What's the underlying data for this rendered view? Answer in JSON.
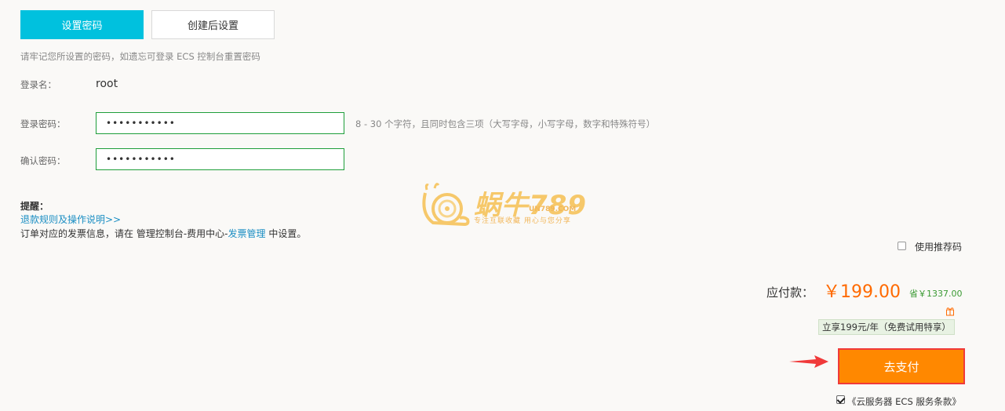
{
  "tabs": {
    "set_password": "设置密码",
    "after_create": "创建后设置"
  },
  "hint_top": "请牢记您所设置的密码，如遗忘可登录 ECS 控制台重置密码",
  "login_name": {
    "label": "登录名：",
    "value": "root"
  },
  "login_password": {
    "label": "登录密码：",
    "value": "•••••••••••",
    "hint": "8 - 30 个字符，且同时包含三项（大写字母，小写字母，数字和特殊符号）"
  },
  "confirm_password": {
    "label": "确认密码：",
    "value": "•••••••••••"
  },
  "reminder": {
    "title": "提醒：",
    "refund_link": "退款规则及操作说明>>",
    "invoice_prefix": "订单对应的发票信息，请在 管理控制台-费用中心-",
    "invoice_link": "发票管理",
    "invoice_suffix": " 中设置。"
  },
  "watermark": {
    "title": "蜗牛789",
    "url": "UN789.COM",
    "subtitle": "专注互联收藏   用心与您分享"
  },
  "referral": {
    "label": "使用推荐码",
    "checked": false
  },
  "payment": {
    "label": "应付款：",
    "price": "￥199.00",
    "save": "省￥1337.00",
    "promo": "立享199元/年（免费试用特享）",
    "pay_button": "去支付",
    "terms": "《云服务器 ECS 服务条款》",
    "terms_checked": true
  },
  "colors": {
    "accent": "#00c1de",
    "price": "#ff6a00",
    "pay_button": "#ff8800",
    "link": "#1b8ec3"
  }
}
